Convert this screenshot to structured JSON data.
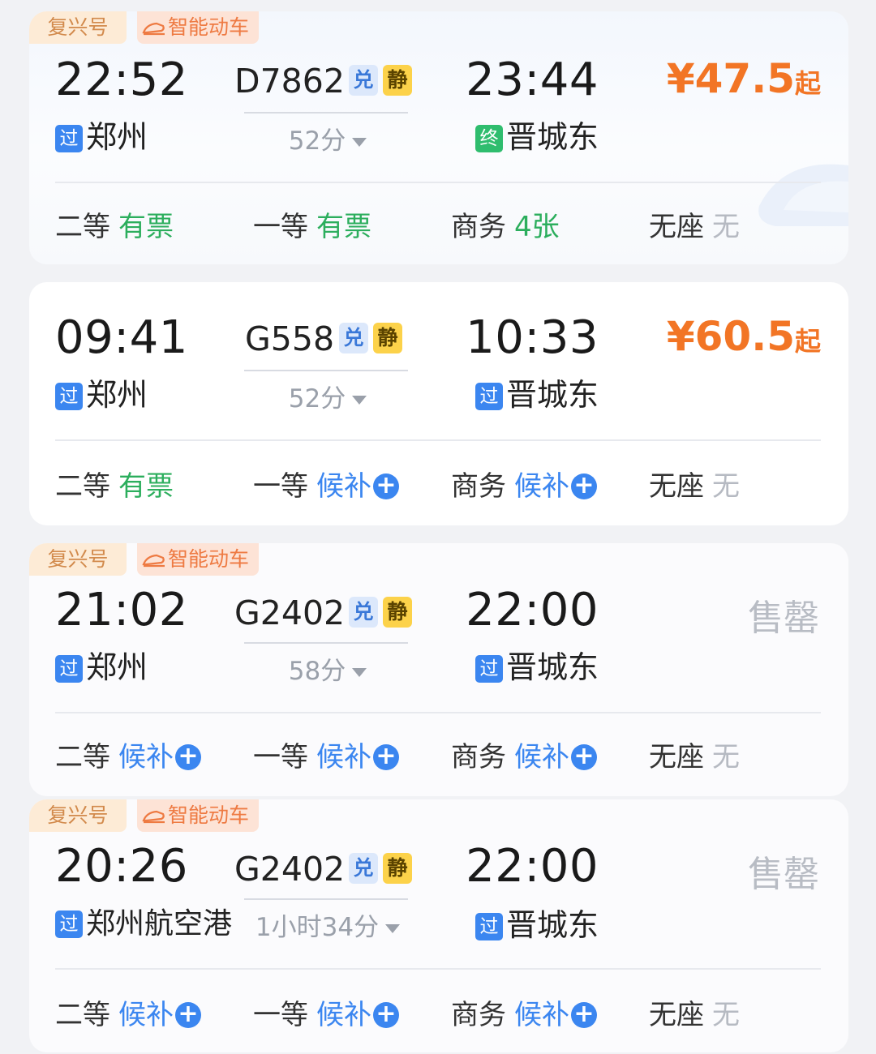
{
  "colors": {
    "accent_price": "#f27525",
    "available_green": "#2cae5d",
    "waitlist_blue": "#3b86f0",
    "none_gray": "#b6bac2",
    "pass_badge": "#3b86f0",
    "end_badge": "#2fbd6e",
    "jing_badge": "#fcd24a"
  },
  "labels": {
    "fuxing_tag": "复兴号",
    "smart_tag": "智能动车",
    "dui_badge": "兑",
    "jing_badge": "静",
    "pass_badge": "过",
    "end_badge": "终",
    "price_suffix": "起",
    "sold_out": "售罄",
    "waitlist_icon": "plus-circle-icon"
  },
  "trains": [
    {
      "tags": true,
      "dep_time": "22:52",
      "train_no": "D7862",
      "arr_time": "23:44",
      "duration": "52分",
      "dep_station": "郑州",
      "dep_type": "过",
      "arr_station": "晋城东",
      "arr_type": "终",
      "price": "¥47.5",
      "sold_out": false,
      "seats": [
        {
          "class": "二等",
          "status": "有票"
        },
        {
          "class": "一等",
          "status": "有票"
        },
        {
          "class": "商务",
          "status": "4张"
        },
        {
          "class": "无座",
          "status": "无"
        }
      ]
    },
    {
      "tags": false,
      "dep_time": "09:41",
      "train_no": "G558",
      "arr_time": "10:33",
      "duration": "52分",
      "dep_station": "郑州",
      "dep_type": "过",
      "arr_station": "晋城东",
      "arr_type": "过",
      "price": "¥60.5",
      "sold_out": false,
      "seats": [
        {
          "class": "二等",
          "status": "有票"
        },
        {
          "class": "一等",
          "status": "候补"
        },
        {
          "class": "商务",
          "status": "候补"
        },
        {
          "class": "无座",
          "status": "无"
        }
      ]
    },
    {
      "tags": true,
      "dep_time": "21:02",
      "train_no": "G2402",
      "arr_time": "22:00",
      "duration": "58分",
      "dep_station": "郑州",
      "dep_type": "过",
      "arr_station": "晋城东",
      "arr_type": "过",
      "price": "",
      "sold_out": true,
      "seats": [
        {
          "class": "二等",
          "status": "候补"
        },
        {
          "class": "一等",
          "status": "候补"
        },
        {
          "class": "商务",
          "status": "候补"
        },
        {
          "class": "无座",
          "status": "无"
        }
      ]
    },
    {
      "tags": true,
      "dep_time": "20:26",
      "train_no": "G2402",
      "arr_time": "22:00",
      "duration": "1小时34分",
      "dep_station": "郑州航空港",
      "dep_type": "过",
      "arr_station": "晋城东",
      "arr_type": "过",
      "price": "",
      "sold_out": true,
      "seats": [
        {
          "class": "二等",
          "status": "候补"
        },
        {
          "class": "一等",
          "status": "候补"
        },
        {
          "class": "商务",
          "status": "候补"
        },
        {
          "class": "无座",
          "status": "无"
        }
      ]
    }
  ]
}
